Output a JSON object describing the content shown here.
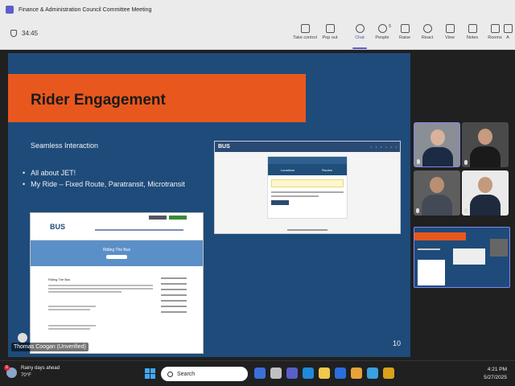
{
  "window": {
    "title": "Finance & Administration Council Committee Meeting"
  },
  "toolbar": {
    "timer": "34:45",
    "people_count": "5",
    "buttons": [
      {
        "id": "take-control",
        "label": "Take control",
        "icon": "cast-icon"
      },
      {
        "id": "pop-out",
        "label": "Pop out",
        "icon": "pop-out-icon"
      },
      {
        "id": "chat",
        "label": "Chat",
        "icon": "chat-icon"
      },
      {
        "id": "people",
        "label": "People",
        "icon": "people-icon"
      },
      {
        "id": "raise",
        "label": "Raise",
        "icon": "hand-icon"
      },
      {
        "id": "react",
        "label": "React",
        "icon": "smiley-icon"
      },
      {
        "id": "view",
        "label": "View",
        "icon": "grid-icon"
      },
      {
        "id": "notes",
        "label": "Notes",
        "icon": "notes-icon"
      },
      {
        "id": "rooms",
        "label": "Rooms",
        "icon": "rooms-icon"
      },
      {
        "id": "apps",
        "label": "A",
        "icon": "apps-icon"
      }
    ],
    "active": "chat"
  },
  "slide": {
    "title": "Rider Engagement",
    "subheading": "Seamless Interaction",
    "bullets": [
      "All about JET!",
      "My Ride – Fixed Route, Paratransit, Microtransit"
    ],
    "page_number": "10",
    "presenter_name": "Thomas Coogan (Unverified)",
    "site1": {
      "logo": "BUS",
      "tab_left": "Locations",
      "tab_right": "Routes"
    },
    "site2": {
      "logo": "BUS",
      "hero_title": "Riding The Bus",
      "section_heading": "Riding The Bus"
    }
  },
  "colors": {
    "slide_bg": "#1e4b7a",
    "banner": "#e8581e",
    "teams_accent": "#5b5fc7"
  },
  "taskbar": {
    "weather_line1": "Rainy days ahead",
    "weather_line2": "70°F",
    "weather_badge": "6",
    "search_placeholder": "Search",
    "time": "4:21 PM",
    "date": "5/27/2025"
  }
}
